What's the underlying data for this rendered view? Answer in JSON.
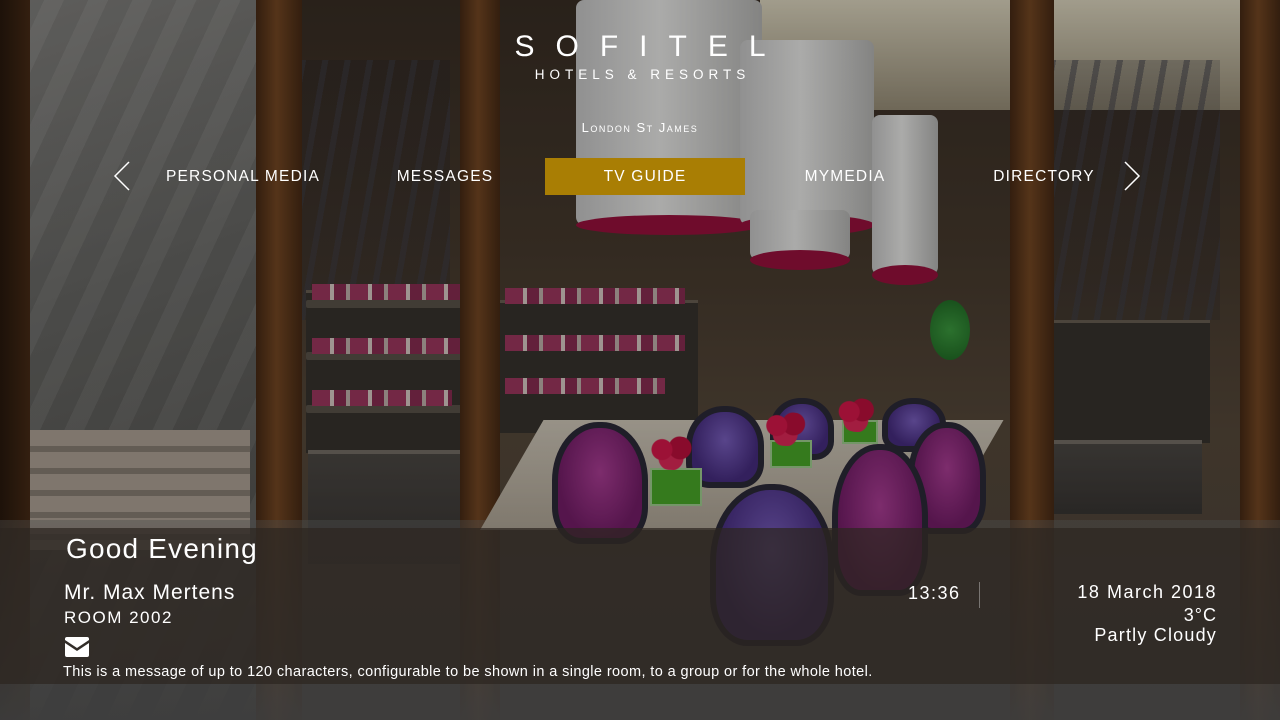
{
  "brand": {
    "name": "SOFITEL",
    "subtitle": "HOTELS & RESORTS",
    "location": "London St James"
  },
  "nav": {
    "items": [
      {
        "label": "PERSONAL MEDIA"
      },
      {
        "label": "MESSAGES"
      },
      {
        "label": "TV GUIDE",
        "active": true
      },
      {
        "label": "MYMEDIA"
      },
      {
        "label": "DIRECTORY"
      }
    ],
    "prev_icon": "chevron-left-icon",
    "next_icon": "chevron-right-icon"
  },
  "welcome": {
    "greeting": "Good Evening",
    "guest_name": "Mr. Max Mertens",
    "room": "ROOM 2002",
    "message_icon": "envelope-icon",
    "message": "This is a message of up to 120 characters, configurable to be shown in a single room, to a group or for the whole hotel."
  },
  "status": {
    "time": "13:36",
    "date": "18 March 2018",
    "temperature": "3°C",
    "weather": "Partly Cloudy"
  },
  "colors": {
    "accent": "#a97e04",
    "panel": "#2d2620"
  }
}
